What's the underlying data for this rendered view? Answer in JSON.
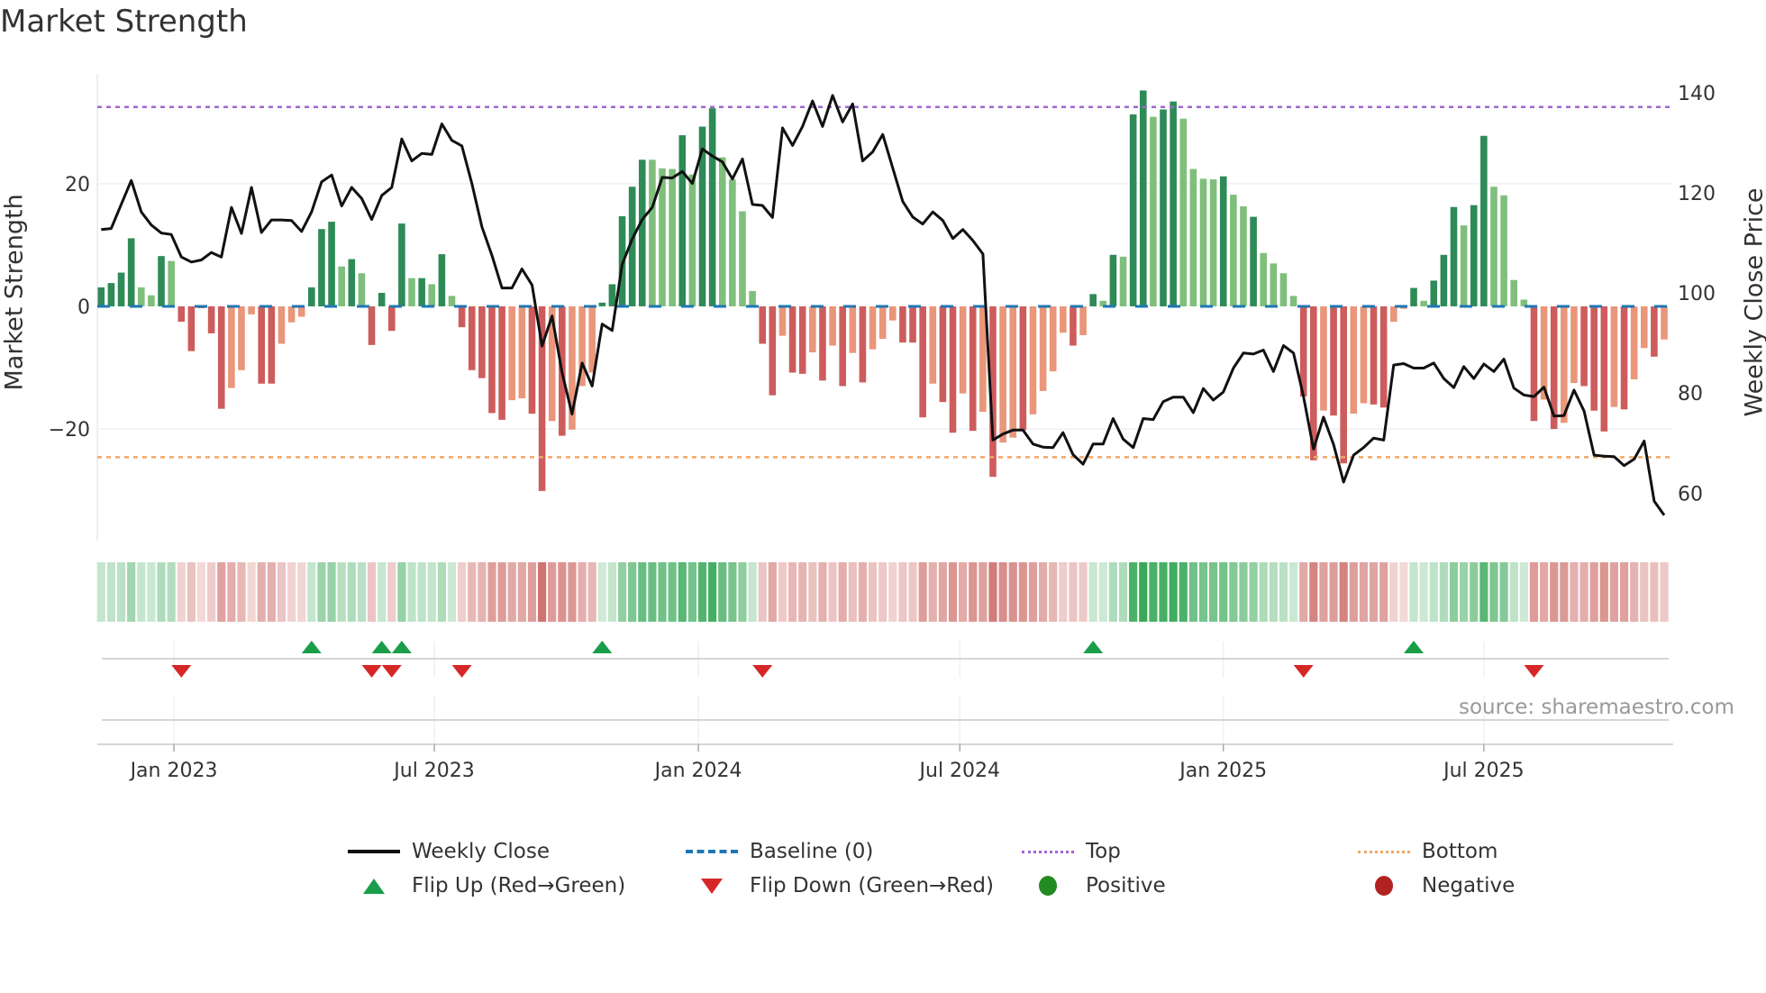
{
  "title": "Market Strength",
  "source": "source: sharemaestro.com",
  "colors": {
    "green_dark": "#2e8b57",
    "green_light": "#7fbf7b",
    "red_dark": "#cd5c5c",
    "red_light": "#e9967a",
    "line": "#111111",
    "baseline": "#1f77b4",
    "top": "#a066d3",
    "bottom": "#f0a868",
    "flip_up": "#1a9e4a",
    "flip_down": "#d62728",
    "positive": "#228b22",
    "negative": "#b22222",
    "heat_green": "#2ea44f",
    "heat_red": "#c65a55"
  },
  "legend": {
    "weekly_close": "Weekly Close",
    "baseline": "Baseline (0)",
    "top": "Top",
    "bottom": "Bottom",
    "flip_up": "Flip Up (Red→Green)",
    "flip_down": "Flip Down (Green→Red)",
    "positive": "Positive",
    "negative": "Negative"
  },
  "chart_data": {
    "type": "bar",
    "title": "Market Strength",
    "ylabel": "Market Strength",
    "y2label": "Weekly Close Price",
    "ylim": [
      -38.2,
      37.9
    ],
    "y2lim": [
      50.5,
      143.8
    ],
    "y_ticks": [
      {
        "label": "20",
        "value": 20
      },
      {
        "label": "0",
        "value": 0
      },
      {
        "label": "−20",
        "value": -20
      }
    ],
    "y2_ticks": [
      {
        "label": "140",
        "value": 140
      },
      {
        "label": "120",
        "value": 120
      },
      {
        "label": "100",
        "value": 100
      },
      {
        "label": "80",
        "value": 80
      },
      {
        "label": "60",
        "value": 60
      }
    ],
    "x_ticks": [
      {
        "label": "Jan 2023",
        "week": 7.26
      },
      {
        "label": "Jul 2023",
        "week": 33.25
      },
      {
        "label": "Jan 2024",
        "week": 59.6
      },
      {
        "label": "Jul 2024",
        "week": 85.7
      },
      {
        "label": "Jan 2025",
        "week": 112.0
      },
      {
        "label": "Jul 2025",
        "week": 138.0
      }
    ],
    "top_level": 32.5,
    "bottom_level": -24.6,
    "baseline": 0,
    "strength": [
      3.1,
      3.8,
      5.5,
      11.1,
      3.1,
      1.8,
      8.2,
      7.4,
      -2.5,
      -7.3,
      -0.3,
      -4.4,
      -16.7,
      -13.3,
      -10.4,
      -1.3,
      -12.6,
      -12.6,
      -6.1,
      -2.6,
      -1.7,
      3.1,
      12.6,
      13.8,
      6.5,
      7.7,
      5.4,
      -6.3,
      2.2,
      -4.0,
      13.5,
      4.6,
      4.6,
      3.6,
      8.5,
      1.7,
      -3.4,
      -10.4,
      -11.7,
      -17.4,
      -18.5,
      -15.3,
      -15.0,
      -17.5,
      -30.1,
      -18.7,
      -21.1,
      -20.1,
      -13.0,
      -10.8,
      0.6,
      3.6,
      14.7,
      19.5,
      23.9,
      23.9,
      22.5,
      22.4,
      27.9,
      21.5,
      29.3,
      32.3,
      24.3,
      20.7,
      15.5,
      2.5,
      -6.1,
      -14.5,
      -4.8,
      -10.8,
      -11.0,
      -7.5,
      -12.1,
      -6.4,
      -13.0,
      -7.6,
      -12.4,
      -7.0,
      -5.3,
      -2.3,
      -5.9,
      -5.9,
      -18.1,
      -12.6,
      -15.6,
      -20.6,
      -14.2,
      -20.3,
      -17.2,
      -27.8,
      -22.2,
      -21.4,
      -20.2,
      -17.6,
      -13.8,
      -10.6,
      -4.3,
      -6.4,
      -4.7,
      2.0,
      0.9,
      8.4,
      8.1,
      31.3,
      35.2,
      30.9,
      32.1,
      33.4,
      30.6,
      22.4,
      20.8,
      20.7,
      21.2,
      18.2,
      16.3,
      14.6,
      8.7,
      7.0,
      5.4,
      1.7,
      -14.7,
      -25.1,
      -17.0,
      -17.8,
      -25.6,
      -17.5,
      -15.8,
      -16.0,
      -16.5,
      -2.5,
      -0.4,
      3.0,
      0.9,
      4.2,
      8.4,
      16.2,
      13.2,
      16.5,
      27.8,
      19.5,
      18.1,
      4.3,
      1.1,
      -18.7,
      -15.2,
      -20.0,
      -19.0,
      -12.5,
      -13.0,
      -17.0,
      -20.4,
      -16.4,
      -16.8,
      -11.9,
      -6.8,
      -8.2,
      -5.4
    ],
    "bar_shade_dark": [
      1,
      1,
      1,
      1,
      0,
      0,
      1,
      0,
      1,
      1,
      1,
      1,
      1,
      0,
      0,
      0,
      1,
      1,
      0,
      0,
      0,
      1,
      1,
      1,
      0,
      1,
      0,
      1,
      1,
      1,
      1,
      0,
      1,
      0,
      1,
      0,
      1,
      1,
      1,
      1,
      1,
      0,
      0,
      1,
      1,
      0,
      1,
      0,
      0,
      0,
      1,
      1,
      1,
      1,
      1,
      0,
      0,
      0,
      1,
      0,
      1,
      1,
      0,
      0,
      0,
      0,
      1,
      1,
      0,
      1,
      1,
      0,
      1,
      0,
      1,
      0,
      1,
      0,
      0,
      0,
      1,
      1,
      1,
      0,
      1,
      1,
      0,
      1,
      0,
      1,
      0,
      0,
      1,
      0,
      0,
      0,
      0,
      1,
      0,
      1,
      0,
      1,
      0,
      1,
      1,
      0,
      1,
      1,
      0,
      0,
      0,
      0,
      1,
      0,
      0,
      1,
      0,
      0,
      0,
      0,
      1,
      1,
      0,
      1,
      1,
      0,
      0,
      1,
      1,
      0,
      0,
      1,
      0,
      1,
      1,
      1,
      0,
      1,
      1,
      0,
      0,
      0,
      0,
      1,
      0,
      1,
      0,
      0,
      1,
      1,
      1,
      0,
      1,
      0,
      0,
      1,
      0
    ],
    "weekly_close": [
      112.7,
      112.9,
      117.7,
      122.5,
      116.2,
      113.6,
      112.0,
      111.7,
      107.2,
      106.2,
      106.6,
      108.1,
      107.2,
      117.1,
      111.9,
      121.1,
      112.1,
      114.6,
      114.6,
      114.5,
      112.3,
      116.2,
      122.2,
      123.6,
      117.4,
      121.1,
      118.9,
      114.7,
      119.5,
      121.1,
      130.8,
      126.4,
      127.9,
      127.7,
      133.8,
      130.5,
      129.4,
      121.9,
      113.2,
      107.5,
      101.0,
      101.0,
      104.8,
      101.6,
      89.4,
      95.4,
      84.1,
      75.8,
      86.0,
      81.4,
      93.8,
      92.5,
      105.7,
      110.8,
      114.7,
      117.1,
      123.1,
      123.0,
      124.3,
      121.9,
      128.8,
      127.4,
      126.2,
      122.8,
      126.8,
      117.7,
      117.5,
      115.1,
      133.0,
      129.5,
      133.3,
      138.4,
      133.3,
      139.5,
      134.2,
      137.8,
      126.4,
      128.2,
      131.7,
      125.0,
      118.3,
      115.2,
      113.8,
      116.2,
      114.5,
      110.9,
      112.7,
      110.5,
      107.8,
      70.6,
      71.8,
      72.6,
      72.6,
      69.8,
      69.2,
      69.1,
      72.1,
      67.7,
      65.8,
      69.8,
      69.8,
      74.9,
      70.8,
      69.1,
      74.9,
      74.7,
      78.3,
      79.2,
      79.2,
      76.1,
      80.9,
      78.6,
      80.2,
      85.0,
      88.0,
      87.8,
      88.6,
      84.3,
      89.5,
      88.0,
      79.3,
      68.8,
      75.2,
      69.7,
      62.2,
      67.6,
      69.1,
      71.0,
      70.6,
      85.6,
      85.9,
      85.0,
      85.0,
      86.0,
      82.9,
      81.1,
      85.3,
      82.9,
      85.8,
      84.3,
      86.8,
      81.0,
      79.6,
      79.3,
      81.2,
      75.4,
      75.5,
      80.6,
      76.4,
      67.6,
      67.4,
      67.3,
      65.5,
      66.8,
      70.4,
      58.4,
      55.6
    ],
    "flip_up_weeks": [
      21,
      28,
      30,
      50,
      99,
      131
    ],
    "flip_down_weeks": [
      8,
      27,
      29,
      36,
      66,
      120,
      143
    ],
    "grid": true,
    "legend_position": "bottom"
  }
}
